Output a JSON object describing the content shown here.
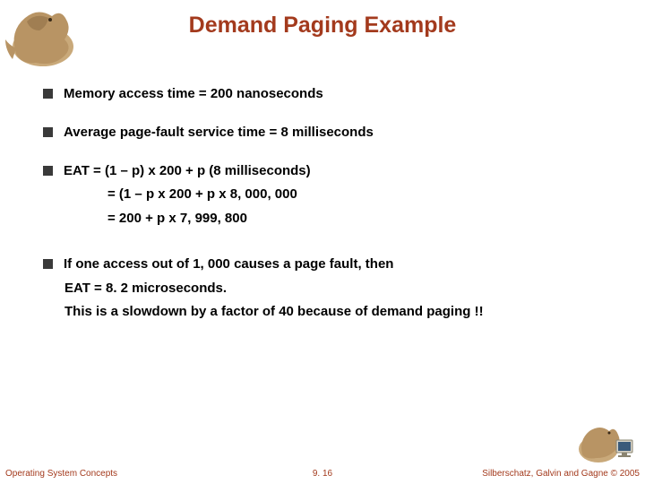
{
  "title": "Demand Paging Example",
  "bullets": {
    "b1": "Memory access time = 200 nanoseconds",
    "b2": "Average page-fault service time = 8 milliseconds",
    "b3": "EAT = (1 – p) x 200 + p (8 milliseconds)",
    "b3_sub1": "= (1 – p  x 200 + p x 8, 000, 000",
    "b3_sub2": "= 200 + p x 7, 999, 800",
    "b4": "If one access out of 1, 000 causes a page fault, then",
    "b4_sub1": "EAT = 8. 2 microseconds.",
    "b4_sub2": "This is a slowdown by a factor of 40 because of demand paging !!"
  },
  "footer": {
    "left": "Operating System Concepts",
    "center": "9. 16",
    "right": "Silberschatz, Galvin and Gagne © 2005"
  },
  "icons": {
    "dino_tl": "dinosaur-illustration",
    "dino_br": "dinosaur-with-monitor-illustration"
  }
}
